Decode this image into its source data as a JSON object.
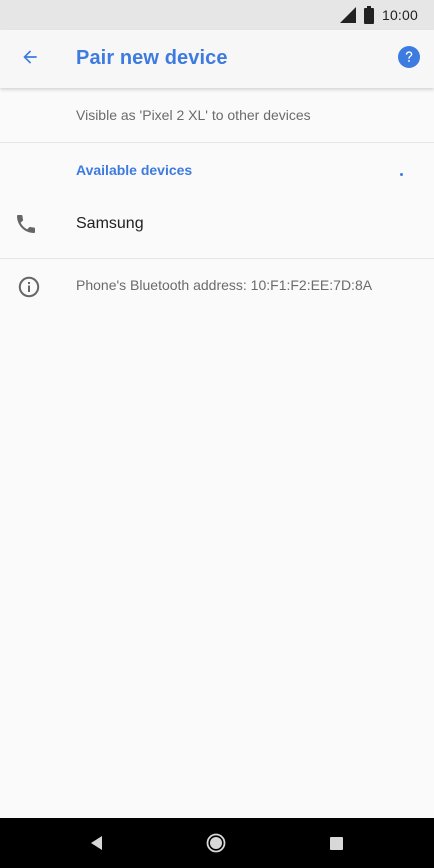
{
  "status_bar": {
    "time": "10:00",
    "icons": [
      "signal-icon",
      "battery-icon"
    ]
  },
  "app_bar": {
    "title": "Pair new device",
    "back_icon": "arrow-left-icon",
    "help_icon": "help-circle-icon"
  },
  "visibility": {
    "text": "Visible as 'Pixel 2 XL' to other devices"
  },
  "available_devices": {
    "header": "Available devices",
    "devices": [
      {
        "name": "Samsung",
        "icon": "phone-icon"
      }
    ]
  },
  "bluetooth_address": {
    "text": "Phone's Bluetooth address: 10:F1:F2:EE:7D:8A",
    "icon": "info-icon"
  },
  "nav_bar": {
    "icons": [
      "nav-back-icon",
      "nav-home-icon",
      "nav-recents-icon"
    ]
  },
  "colors": {
    "accent": "#3d7be0",
    "status_bar_bg": "#e6e6e6",
    "background": "#fafafa",
    "nav_bar_bg": "#000000"
  }
}
